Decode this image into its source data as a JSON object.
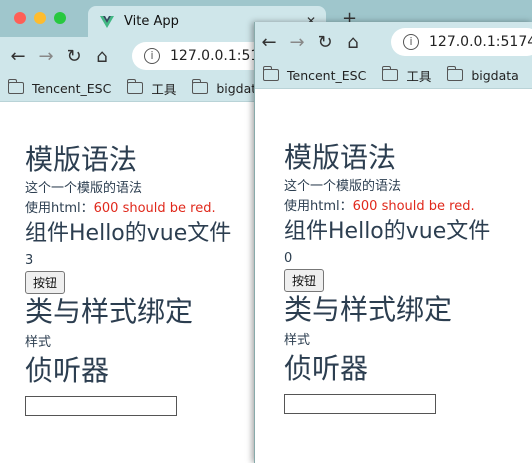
{
  "browser": {
    "tab_title": "Vite App",
    "url_left": "127.0.0.1:517",
    "url_right": "127.0.0.1:5174",
    "bookmarks": [
      "Tencent_ESC",
      "工具",
      "bigdata"
    ]
  },
  "left_page": {
    "h_template": "模版语法",
    "line_template": "这个一个模版的语法",
    "html_prefix": "使用html：",
    "html_red": "600 should be red.",
    "h_component": "组件Hello的vue文件",
    "count": "3",
    "button_label": "按钮",
    "h_class": "类与样式绑定",
    "style_text": "样式",
    "h_watcher": "侦听器"
  },
  "right_page": {
    "h_template": "模版语法",
    "line_template": "这个一个模版的语法",
    "html_prefix": "使用html：",
    "html_red": "600 should be red.",
    "h_component": "组件Hello的vue文件",
    "count": "0",
    "button_label": "按钮",
    "h_class": "类与样式绑定",
    "style_text": "样式",
    "h_watcher": "侦听器"
  },
  "colors": {
    "red_text": "#e0281b",
    "chrome_tabbar": "#9fc6cc",
    "chrome_toolbar": "#cfe6ea"
  }
}
